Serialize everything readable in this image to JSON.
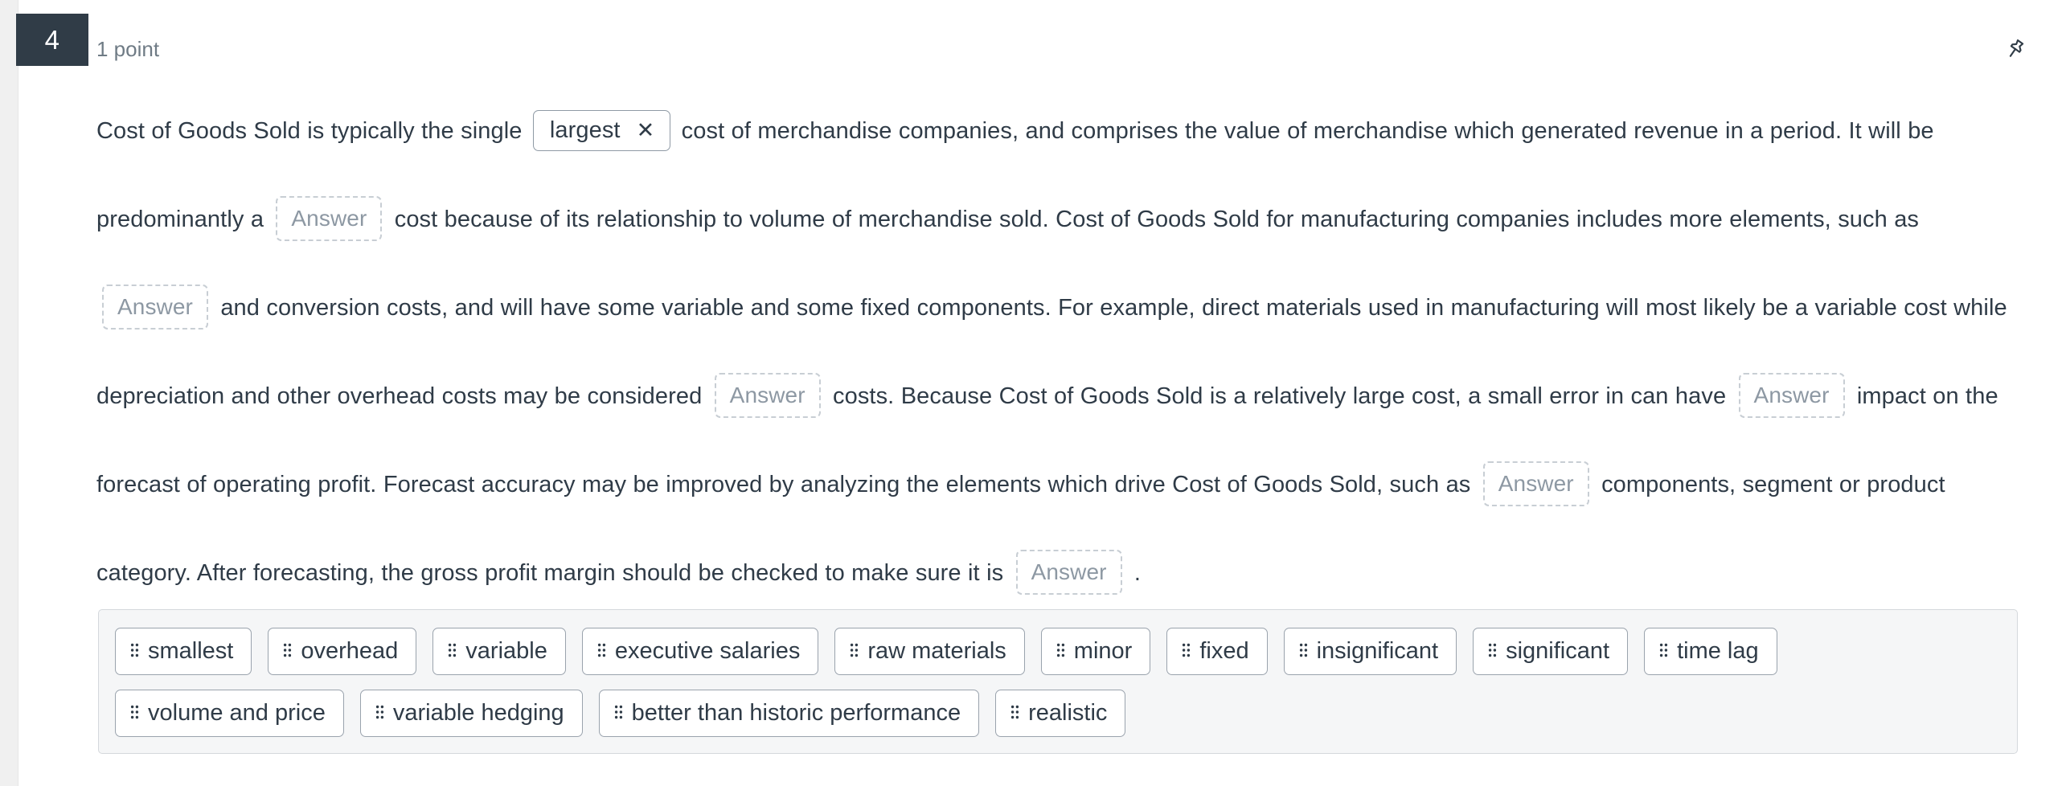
{
  "question": {
    "number": "4",
    "points": "1 point",
    "pin_icon": "pushpin-icon"
  },
  "prompt": {
    "seg1": "Cost of Goods Sold is typically the single ",
    "filled_answer": "largest",
    "remove_icon": "✕",
    "seg2": " cost of merchandise companies, and comprises the value of merchandise which generated revenue in a period. It will be predominantly a ",
    "blank_placeholder": "Answer",
    "seg3": " cost because of its relationship to volume of merchandise sold. Cost of Goods Sold for manufacturing companies includes more elements, such as ",
    "seg4": " and conversion costs, and will have some variable and some fixed components. For example, direct materials used in manufacturing will most likely be a variable cost while depreciation and other overhead costs may be considered ",
    "seg5": " costs. Because Cost of Goods Sold is a relatively large cost, a small error in can have ",
    "seg6": " impact on the forecast of operating profit. Forecast accuracy may be improved by analyzing the elements which drive Cost of Goods Sold, such as ",
    "seg7": " components, segment or product category. After forecasting, the gross profit margin should be checked to make sure it is ",
    "seg8": " ."
  },
  "word_bank": {
    "grip_icon": "drag-handle-icon",
    "tokens": [
      "smallest",
      "overhead",
      "variable",
      "executive salaries",
      "raw materials",
      "minor",
      "fixed",
      "insignificant",
      "significant",
      "time lag",
      "volume and price",
      "variable hedging",
      "better than historic performance",
      "realistic"
    ]
  },
  "colors": {
    "badge_bg": "#303c47",
    "text": "#2f3b47",
    "muted": "#6f7b85",
    "blank_border": "#c8ced4",
    "bank_bg": "#f5f6f7"
  }
}
